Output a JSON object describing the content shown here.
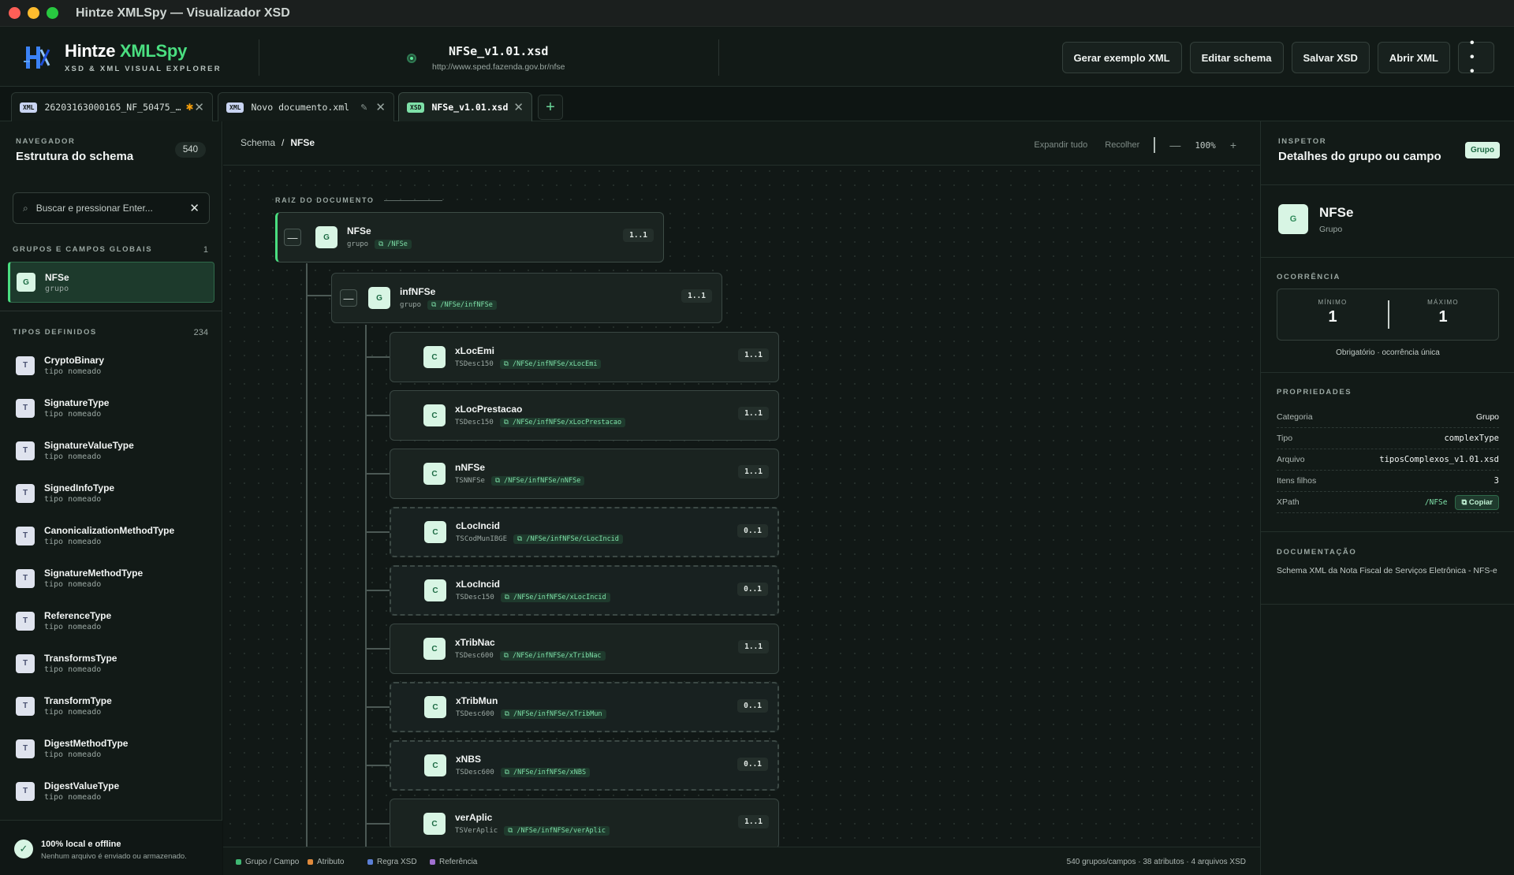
{
  "window": {
    "title": "Hintze XMLSpy — Visualizador XSD"
  },
  "brand": {
    "name_main": "Hintze ",
    "name_accent": "XMLSpy",
    "tagline": "XSD & XML VISUAL EXPLORER"
  },
  "document": {
    "name": "NFSe_v1.01.xsd",
    "namespace": "http://www.sped.fazenda.gov.br/nfse"
  },
  "toolbar": {
    "generate_xml": "Gerar exemplo XML",
    "edit_schema": "Editar schema",
    "save_xsd": "Salvar XSD",
    "open_xml": "Abrir XML",
    "more": "• • •"
  },
  "tabs": [
    {
      "badge": "XML",
      "label": "26203163000165_NF_50475_…",
      "modified": "✱",
      "close": "✕"
    },
    {
      "badge": "XML",
      "label": "Novo documento.xml",
      "edit": "✎",
      "close": "✕"
    },
    {
      "badge": "XSD",
      "label": "NFSe_v1.01.xsd",
      "close": "✕"
    }
  ],
  "tab_add": "+",
  "navigator": {
    "section": "NAVEGADOR",
    "title": "Estrutura do schema",
    "count": "540",
    "search_placeholder": "Buscar e pressionar Enter...",
    "globals_label": "GRUPOS E CAMPOS GLOBAIS",
    "globals_count": "1",
    "global_item": {
      "icon": "G",
      "name": "NFSe",
      "sub": "grupo"
    },
    "types_label": "TIPOS DEFINIDOS",
    "types_count": "234",
    "types": [
      {
        "icon": "T",
        "name": "CryptoBinary",
        "sub": "tipo nomeado"
      },
      {
        "icon": "T",
        "name": "SignatureType",
        "sub": "tipo nomeado"
      },
      {
        "icon": "T",
        "name": "SignatureValueType",
        "sub": "tipo nomeado"
      },
      {
        "icon": "T",
        "name": "SignedInfoType",
        "sub": "tipo nomeado"
      },
      {
        "icon": "T",
        "name": "CanonicalizationMethodType",
        "sub": "tipo nomeado"
      },
      {
        "icon": "T",
        "name": "SignatureMethodType",
        "sub": "tipo nomeado"
      },
      {
        "icon": "T",
        "name": "ReferenceType",
        "sub": "tipo nomeado"
      },
      {
        "icon": "T",
        "name": "TransformsType",
        "sub": "tipo nomeado"
      },
      {
        "icon": "T",
        "name": "TransformType",
        "sub": "tipo nomeado"
      },
      {
        "icon": "T",
        "name": "DigestMethodType",
        "sub": "tipo nomeado"
      },
      {
        "icon": "T",
        "name": "DigestValueType",
        "sub": "tipo nomeado"
      }
    ],
    "footer_title": "100% local e offline",
    "footer_sub": "Nenhum arquivo é enviado ou armazenado.",
    "footer_check": "✓"
  },
  "canvas": {
    "crumb_root": "Schema",
    "crumb_sep": "/",
    "crumb_current": "NFSe",
    "expand_all": "Expandir tudo",
    "collapse_all": "Recolher",
    "zoom_out": "—",
    "zoom": "100%",
    "zoom_in": "+",
    "root_label": "RAIZ DO DOCUMENTO",
    "root_node": {
      "icon": "G",
      "name": "NFSe",
      "kind": "grupo",
      "path": "⧉ /NFSe",
      "occ": "1..1",
      "toggle": "—"
    },
    "group_node": {
      "icon": "G",
      "name": "infNFSe",
      "kind": "grupo",
      "path": "⧉ /NFSe/infNFSe",
      "occ": "1..1",
      "toggle": "—"
    },
    "children": [
      {
        "icon": "C",
        "name": "xLocEmi",
        "type": "TSDesc150",
        "path": "⧉ /NFSe/infNFSe/xLocEmi",
        "occ": "1..1",
        "optional": false
      },
      {
        "icon": "C",
        "name": "xLocPrestacao",
        "type": "TSDesc150",
        "path": "⧉ /NFSe/infNFSe/xLocPrestacao",
        "occ": "1..1",
        "optional": false
      },
      {
        "icon": "C",
        "name": "nNFSe",
        "type": "TSNNFSe",
        "path": "⧉ /NFSe/infNFSe/nNFSe",
        "occ": "1..1",
        "optional": false
      },
      {
        "icon": "C",
        "name": "cLocIncid",
        "type": "TSCodMunIBGE",
        "path": "⧉ /NFSe/infNFSe/cLocIncid",
        "occ": "0..1",
        "optional": true
      },
      {
        "icon": "C",
        "name": "xLocIncid",
        "type": "TSDesc150",
        "path": "⧉ /NFSe/infNFSe/xLocIncid",
        "occ": "0..1",
        "optional": true
      },
      {
        "icon": "C",
        "name": "xTribNac",
        "type": "TSDesc600",
        "path": "⧉ /NFSe/infNFSe/xTribNac",
        "occ": "1..1",
        "optional": false
      },
      {
        "icon": "C",
        "name": "xTribMun",
        "type": "TSDesc600",
        "path": "⧉ /NFSe/infNFSe/xTribMun",
        "occ": "0..1",
        "optional": true
      },
      {
        "icon": "C",
        "name": "xNBS",
        "type": "TSDesc600",
        "path": "⧉ /NFSe/infNFSe/xNBS",
        "occ": "0..1",
        "optional": true
      },
      {
        "icon": "C",
        "name": "verAplic",
        "type": "TSVerAplic",
        "path": "⧉ /NFSe/infNFSe/verAplic",
        "occ": "1..1",
        "optional": false
      }
    ]
  },
  "legend": {
    "items": [
      {
        "label": "Grupo / Campo",
        "color": "#3fb873"
      },
      {
        "label": "Atributo",
        "color": "#e08a3c"
      },
      {
        "label": "Regra XSD",
        "color": "#5b7fd6"
      },
      {
        "label": "Referência",
        "color": "#a070d0"
      }
    ],
    "stats": "540 grupos/campos · 38 atributos · 4 arquivos XSD"
  },
  "inspector": {
    "section": "INSPETOR",
    "title": "Detalhes do grupo ou campo",
    "badge": "Grupo",
    "node_icon": "G",
    "node_name": "NFSe",
    "node_kind": "Grupo",
    "occ_label": "OCORRÊNCIA",
    "min_label": "MÍNIMO",
    "min_value": "1",
    "max_label": "MÁXIMO",
    "max_value": "1",
    "occ_note": "Obrigatório · ocorrência única",
    "props_label": "PROPRIEDADES",
    "props": [
      {
        "key": "Categoria",
        "value": "Grupo"
      },
      {
        "key": "Tipo",
        "value": "complexType"
      },
      {
        "key": "Arquivo",
        "value": "tiposComplexos_v1.01.xsd"
      },
      {
        "key": "Itens filhos",
        "value": "3"
      }
    ],
    "xpath_key": "XPath",
    "xpath_value": "/NFSe",
    "copy": "⧉ Copiar",
    "doc_label": "DOCUMENTAÇÃO",
    "doc_text": "Schema XML da Nota Fiscal de Serviços Eletrônica - NFS-e"
  }
}
